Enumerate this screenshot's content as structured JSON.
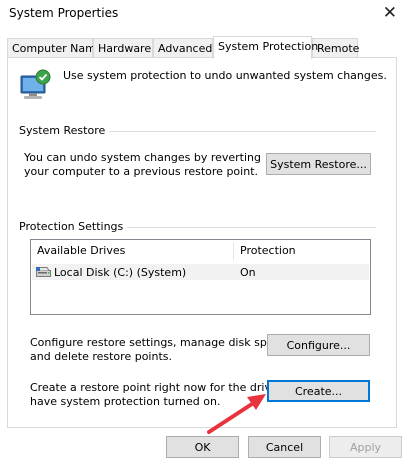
{
  "window": {
    "title": "System Properties"
  },
  "tabs": [
    {
      "label": "Computer Name",
      "active": false
    },
    {
      "label": "Hardware",
      "active": false
    },
    {
      "label": "Advanced",
      "active": false
    },
    {
      "label": "System Protection",
      "active": true
    },
    {
      "label": "Remote",
      "active": false
    }
  ],
  "intro_text": "Use system protection to undo unwanted system changes.",
  "system_restore": {
    "group_label": "System Restore",
    "description_line1": "You can undo system changes by reverting",
    "description_line2": "your computer to a previous restore point.",
    "button_label": "System Restore..."
  },
  "protection": {
    "group_label": "Protection Settings",
    "columns": [
      "Available Drives",
      "Protection"
    ],
    "drives": [
      {
        "name": "Local Disk (C:) (System)",
        "protection": "On"
      }
    ],
    "configure_text_line1": "Configure restore settings, manage disk space,",
    "configure_text_line2": "and delete restore points.",
    "configure_button": "Configure...",
    "create_text_line1": "Create a restore point right now for the drives that",
    "create_text_line2": "have system protection turned on.",
    "create_button": "Create..."
  },
  "footer": {
    "ok": "OK",
    "cancel": "Cancel",
    "apply": "Apply"
  },
  "colors": {
    "focus_border": "#0078d7",
    "arrow": "#e8323c"
  }
}
